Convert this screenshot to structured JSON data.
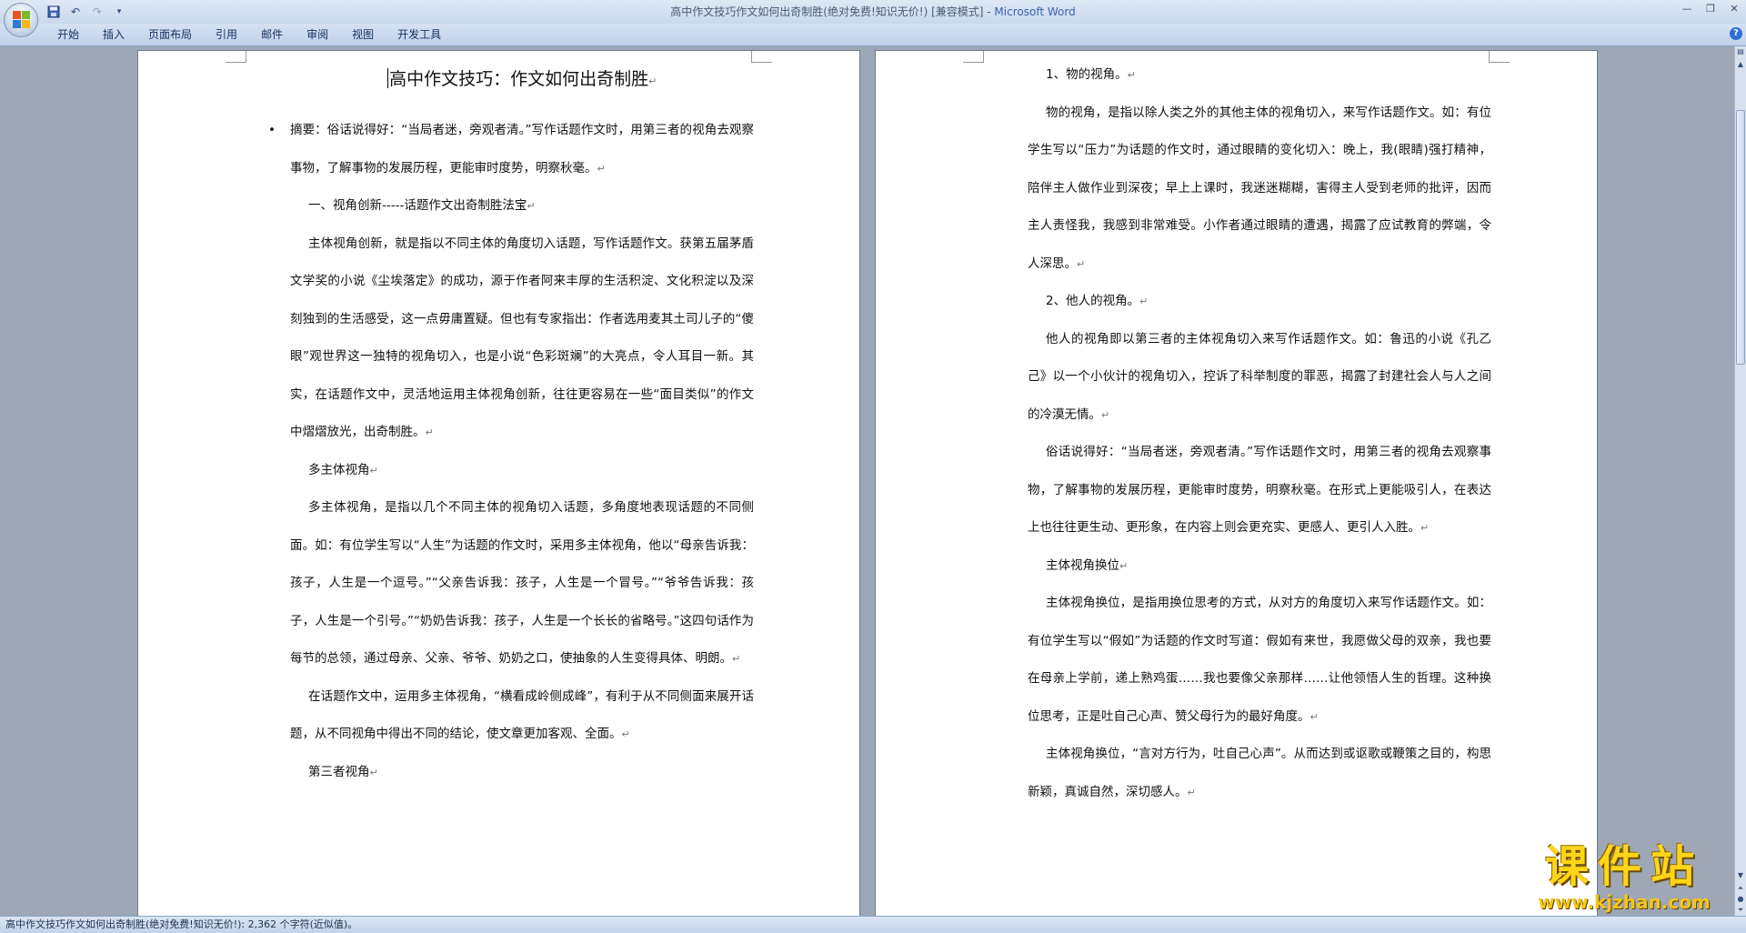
{
  "window": {
    "title_doc": "高中作文技巧作文如何出奇制胜(绝对免费!知识无价!) [兼容模式]",
    "title_sep": " - ",
    "title_app": "Microsoft Word"
  },
  "ribbon": {
    "tabs": [
      "开始",
      "插入",
      "页面布局",
      "引用",
      "邮件",
      "审阅",
      "视图",
      "开发工具"
    ]
  },
  "document": {
    "title": "高中作文技巧：作文如何出奇制胜",
    "left_paragraphs": [
      "摘要：俗话说得好：“当局者迷，旁观者清。”写作话题作文时，用第三者的视角去观察事物，了解事物的发展历程，更能审时度势，明察秋毫。",
      "一、视角创新-----话题作文出奇制胜法宝",
      "主体视角创新，就是指以不同主体的角度切入话题，写作话题作文。获第五届茅盾文学奖的小说《尘埃落定》的成功，源于作者阿来丰厚的生活积淀、文化积淀以及深刻独到的生活感受，这一点毋庸置疑。但也有专家指出：作者选用麦其土司儿子的“傻眼”观世界这一独特的视角切入，也是小说“色彩斑斓”的大亮点，令人耳目一新。其实，在话题作文中，灵活地运用主体视角创新，往往更容易在一些“面目类似”的作文中熠熠放光，出奇制胜。",
      "多主体视角",
      "多主体视角，是指以几个不同主体的视角切入话题，多角度地表现话题的不同侧面。如：有位学生写以“人生”为话题的作文时，采用多主体视角，他以“母亲告诉我：孩子，人生是一个逗号。”“父亲告诉我：孩子，人生是一个冒号。”“爷爷告诉我：孩子，人生是一个引号。”“奶奶告诉我：孩子，人生是一个长长的省略号。”这四句话作为每节的总领，通过母亲、父亲、爷爷、奶奶之口，使抽象的人生变得具体、明朗。",
      "在话题作文中，运用多主体视角，“横看成岭侧成峰”，有利于从不同侧面来展开话题，从不同视角中得出不同的结论，使文章更加客观、全面。",
      "第三者视角"
    ],
    "right_paragraphs": [
      "1、物的视角。",
      "物的视角，是指以除人类之外的其他主体的视角切入，来写作话题作文。如：有位学生写以“压力”为话题的作文时，通过眼睛的变化切入：晚上，我(眼睛)强打精神，陪伴主人做作业到深夜；早上上课时，我迷迷糊糊，害得主人受到老师的批评，因而主人责怪我，我感到非常难受。小作者通过眼睛的遭遇，揭露了应试教育的弊端，令人深思。",
      "2、他人的视角。",
      "他人的视角即以第三者的主体视角切入来写作话题作文。如：鲁迅的小说《孔乙己》以一个小伙计的视角切入，控诉了科举制度的罪恶，揭露了封建社会人与人之间的冷漠无情。",
      "俗话说得好：“当局者迷，旁观者清。”写作话题作文时，用第三者的视角去观察事物，了解事物的发展历程，更能审时度势，明察秋毫。在形式上更能吸引人，在表达上也往往更生动、更形象，在内容上则会更充实、更感人、更引人入胜。",
      "主体视角换位",
      "主体视角换位，是指用换位思考的方式，从对方的角度切入来写作话题作文。如：有位学生写以“假如”为话题的作文时写道：假如有来世，我愿做父母的双亲，我也要在母亲上学前，递上熟鸡蛋……我也要像父亲那样……让他领悟人生的哲理。这种换位思考，正是吐自己心声、赞父母行为的最好角度。",
      "主体视角换位，“言对方行为，吐自己心声”。从而达到或讴歌或鞭策之目的，构思新颖，真诚自然，深切感人。"
    ],
    "paragraph_mark": "↵"
  },
  "status": {
    "text": "高中作文技巧作文如何出奇制胜(绝对免费!知识无价!): 2,362 个字符(近似值)。"
  },
  "watermark": {
    "cn": "课件站",
    "url": "www.kjzhan.com"
  },
  "colors": {
    "ribbon_bg": "#d6e2f3",
    "doc_bg": "#9da7b6",
    "title_app": "#3a62b0",
    "watermark": "#ffd51a"
  }
}
